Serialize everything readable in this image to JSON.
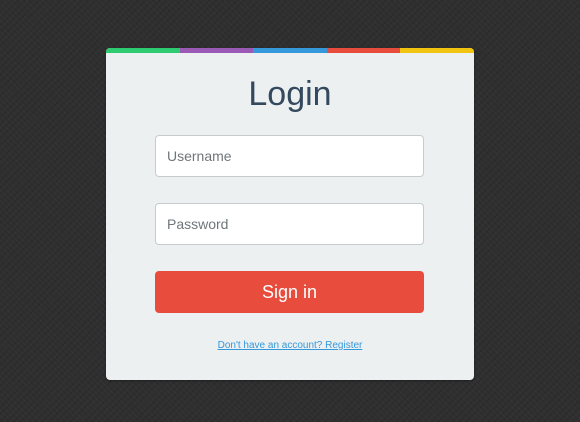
{
  "colors": {
    "background": "#2f2f30",
    "card": "#ecf0f1",
    "title": "#34495e",
    "signin_button": "#e74c3c",
    "link": "#3498db",
    "stripe": [
      "#2ecc71",
      "#9b59b6",
      "#3498db",
      "#e74c3c",
      "#f1c40f"
    ]
  },
  "login": {
    "title": "Login",
    "username": {
      "value": "",
      "placeholder": "Username"
    },
    "password": {
      "value": "",
      "placeholder": "Password"
    },
    "signin_label": "Sign in",
    "register_link": "Don't have an account? Register"
  }
}
